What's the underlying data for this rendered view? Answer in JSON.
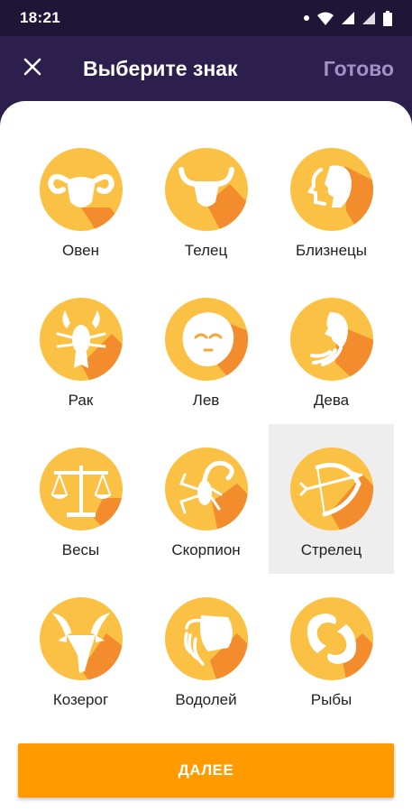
{
  "status_bar": {
    "time": "18:21",
    "icons": [
      "notification-dot-icon",
      "wifi-icon",
      "signal-icon",
      "signal-icon",
      "battery-icon"
    ]
  },
  "app_bar": {
    "title": "Выберите знак",
    "done_label": "Готово",
    "close_icon": "close-icon",
    "background": "#2c1f4d",
    "done_color": "#a292c4"
  },
  "signs": [
    {
      "label": "Овен",
      "icon": "aries-icon",
      "selected": false
    },
    {
      "label": "Телец",
      "icon": "taurus-icon",
      "selected": false
    },
    {
      "label": "Близнецы",
      "icon": "gemini-icon",
      "selected": false
    },
    {
      "label": "Рак",
      "icon": "cancer-icon",
      "selected": false
    },
    {
      "label": "Лев",
      "icon": "leo-icon",
      "selected": false
    },
    {
      "label": "Дева",
      "icon": "virgo-icon",
      "selected": false
    },
    {
      "label": "Весы",
      "icon": "libra-icon",
      "selected": false
    },
    {
      "label": "Скорпион",
      "icon": "scorpio-icon",
      "selected": false
    },
    {
      "label": "Стрелец",
      "icon": "sagittarius-icon",
      "selected": true
    },
    {
      "label": "Козерог",
      "icon": "capricorn-icon",
      "selected": false
    },
    {
      "label": "Водолей",
      "icon": "aquarius-icon",
      "selected": false
    },
    {
      "label": "Рыбы",
      "icon": "pisces-icon",
      "selected": false
    }
  ],
  "colors": {
    "icon_circle": "#fbc145",
    "icon_shadow": "#f28c2c",
    "next_button": "#ff9a00",
    "selected_cell": "#eeeeee"
  },
  "next_button": {
    "label": "ДАЛЕЕ"
  }
}
